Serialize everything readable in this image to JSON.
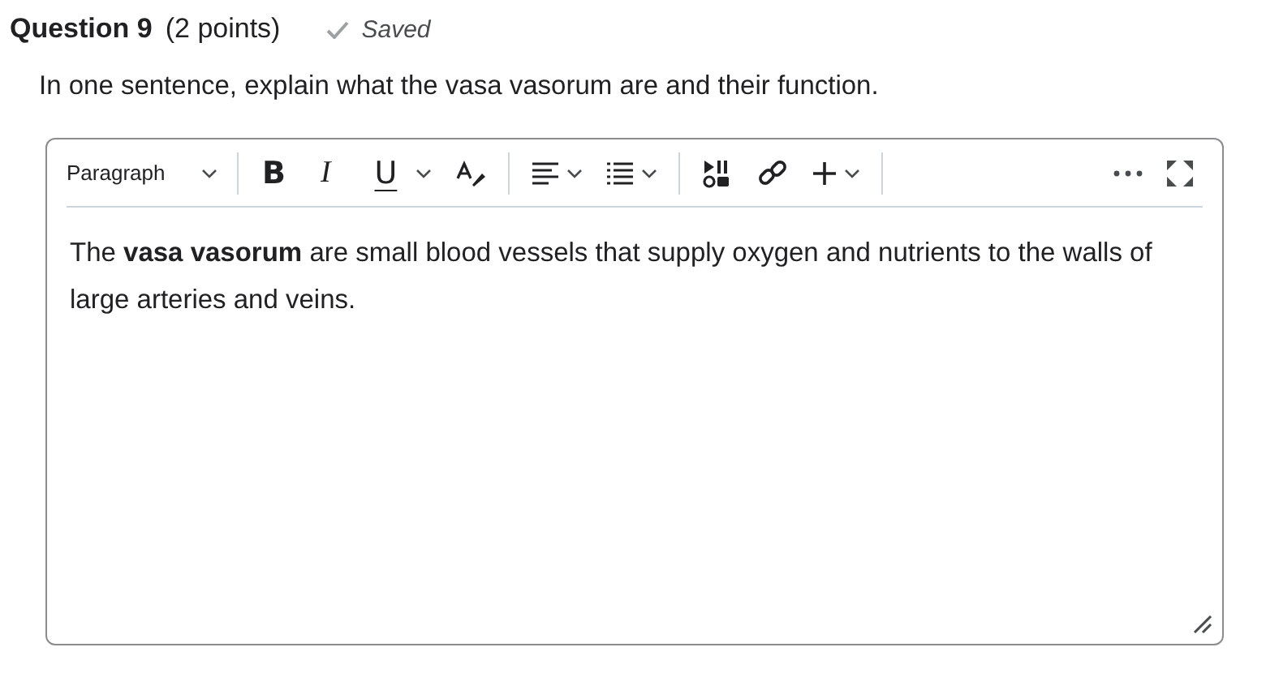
{
  "question": {
    "title": "Question 9",
    "points": "(2 points)",
    "saved": true,
    "status": "Saved"
  },
  "prompt": "In one sentence, explain what the vasa vasorum are and their function.",
  "editor": {
    "block_format": "Paragraph",
    "format_buttons": [
      {
        "label": "B",
        "kind": "bold"
      },
      {
        "label": "I",
        "kind": "italic"
      },
      {
        "label": "U",
        "kind": "underline"
      }
    ],
    "answer": "The **vasa vasorum** are small blood vessels that supply oxygen and nutrients to the walls of large arteries and veins."
  }
}
